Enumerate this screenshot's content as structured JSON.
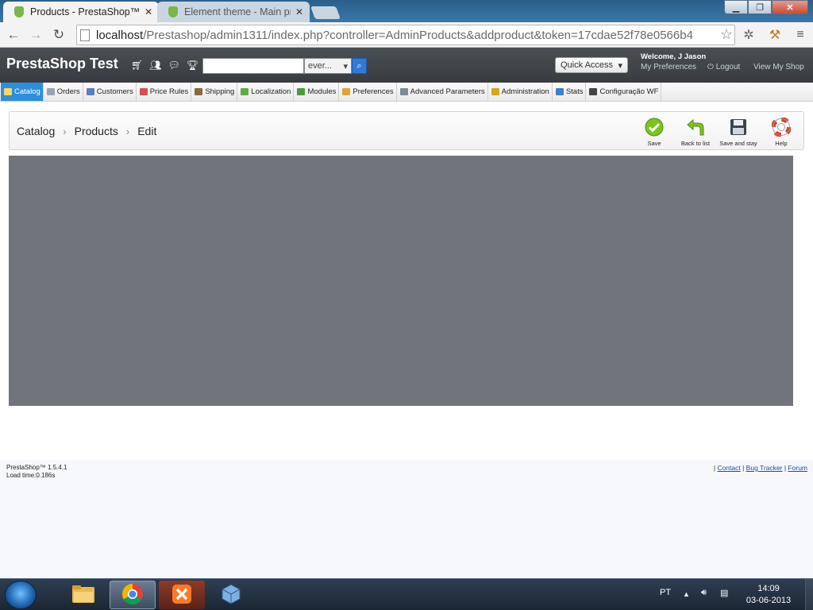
{
  "browser": {
    "tabs": [
      {
        "title": "Products - PrestaShop™",
        "active": true
      },
      {
        "title": "Element theme - Main pro",
        "active": false
      }
    ],
    "url_host": "localhost",
    "url_path": "/Prestashop/admin1311/index.php?controller=AdminProducts&addproduct&token=17cdae52f78e0566b4"
  },
  "header": {
    "shop_name": "PrestaShop Test",
    "search_scope": "ever...",
    "search_placeholder": "",
    "quick_access": "Quick Access",
    "welcome": "Welcome, J Jason",
    "my_preferences": "My Preferences",
    "logout": "Logout",
    "view_shop": "View My Shop"
  },
  "menu": [
    {
      "label": "Catalog",
      "icon_color": "#f3c84a",
      "active": true
    },
    {
      "label": "Orders",
      "icon_color": "#9aa4b0"
    },
    {
      "label": "Customers",
      "icon_color": "#5a7fbf"
    },
    {
      "label": "Price Rules",
      "icon_color": "#d94f4f"
    },
    {
      "label": "Shipping",
      "icon_color": "#8a6a3c"
    },
    {
      "label": "Localization",
      "icon_color": "#5fae3d"
    },
    {
      "label": "Modules",
      "icon_color": "#4c9b3a"
    },
    {
      "label": "Preferences",
      "icon_color": "#e0a43a"
    },
    {
      "label": "Advanced Parameters",
      "icon_color": "#7a8a99"
    },
    {
      "label": "Administration",
      "icon_color": "#d9a51f"
    },
    {
      "label": "Stats",
      "icon_color": "#3f7fd1"
    },
    {
      "label": "Configuração WF",
      "icon_color": "#444444"
    }
  ],
  "breadcrumb": [
    "Catalog",
    "Products",
    "Edit"
  ],
  "toolbar": {
    "save": "Save",
    "back": "Back to list",
    "save_stay": "Save and stay",
    "help": "Help"
  },
  "footer": {
    "version": "PrestaShop™ 1.5.4.1",
    "load_time": "Load time:0.186s",
    "contact": "Contact",
    "bug_tracker": "Bug Tracker",
    "forum": "Forum"
  },
  "taskbar": {
    "lang": "PT",
    "time": "14:09",
    "date": "03-06-2013"
  }
}
